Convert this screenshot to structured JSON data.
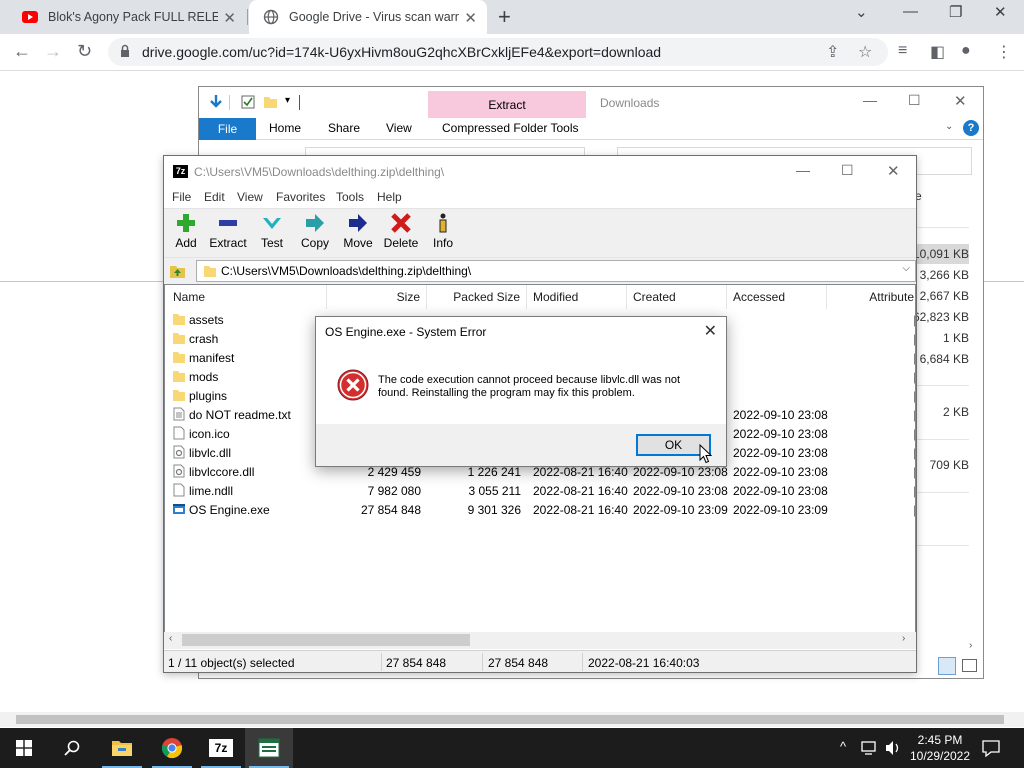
{
  "browser": {
    "tabs": [
      {
        "title": "Blok's Agony Pack FULL RELEASE",
        "active": false
      },
      {
        "title": "Google Drive - Virus scan warning",
        "active": true
      }
    ],
    "url": "drive.google.com/uc?id=174k-U6yxHivm8ouG2qhcXBrCxkljEFe4&export=download"
  },
  "explorer": {
    "ribbon": {
      "file": "File",
      "home": "Home",
      "share": "Share",
      "view": "View",
      "extract": "Extract",
      "compressed_tools": "Compressed Folder Tools",
      "title": "Downloads"
    },
    "column_fragment": "e",
    "sizes": [
      "10,091 KB",
      "3,266 KB",
      "2,667 KB",
      "62,823 KB",
      "1 KB",
      "6,684 KB",
      "2 KB",
      "709 KB"
    ]
  },
  "sevenzip": {
    "title": "C:\\Users\\VM5\\Downloads\\delthing.zip\\delthing\\",
    "menu": [
      "File",
      "Edit",
      "View",
      "Favorites",
      "Tools",
      "Help"
    ],
    "toolbar": [
      {
        "label": "Add",
        "icon": "plus-icon"
      },
      {
        "label": "Extract",
        "icon": "minus-icon"
      },
      {
        "label": "Test",
        "icon": "check-icon"
      },
      {
        "label": "Copy",
        "icon": "copy-arrow-icon"
      },
      {
        "label": "Move",
        "icon": "move-arrow-icon"
      },
      {
        "label": "Delete",
        "icon": "delete-x-icon"
      },
      {
        "label": "Info",
        "icon": "info-icon"
      }
    ],
    "address": "C:\\Users\\VM5\\Downloads\\delthing.zip\\delthing\\",
    "columns": {
      "name": "Name",
      "size": "Size",
      "packed": "Packed Size",
      "modified": "Modified",
      "created": "Created",
      "accessed": "Accessed",
      "attributes": "Attribute"
    },
    "rows": [
      {
        "name": "assets",
        "type": "folder",
        "size": "",
        "packed": "",
        "modified": "",
        "created": "",
        "accessed": ""
      },
      {
        "name": "crash",
        "type": "folder",
        "size": "",
        "packed": "",
        "modified": "",
        "created": "",
        "accessed": ""
      },
      {
        "name": "manifest",
        "type": "folder",
        "size": "",
        "packed": "",
        "modified": "",
        "created": "",
        "accessed": ""
      },
      {
        "name": "mods",
        "type": "folder",
        "size": "",
        "packed": "",
        "modified": "",
        "created": "",
        "accessed": ""
      },
      {
        "name": "plugins",
        "type": "folder",
        "size": "",
        "packed": "",
        "modified": "",
        "created": "",
        "accessed": ""
      },
      {
        "name": "do NOT readme.txt",
        "type": "text",
        "size": "",
        "packed": "",
        "modified": "",
        "created": "",
        "accessed": "2022-09-10 23:08"
      },
      {
        "name": "icon.ico",
        "type": "file",
        "size": "",
        "packed": "",
        "modified": "",
        "created": "",
        "accessed": "2022-09-10 23:08"
      },
      {
        "name": "libvlc.dll",
        "type": "dll",
        "size": "",
        "packed": "",
        "modified": "",
        "created": "",
        "accessed": "2022-09-10 23:08"
      },
      {
        "name": "libvlccore.dll",
        "type": "dll",
        "size": "2 429 459",
        "packed": "1 226 241",
        "modified": "2022-08-21 16:40",
        "created": "2022-09-10 23:08",
        "accessed": "2022-09-10 23:08"
      },
      {
        "name": "lime.ndll",
        "type": "file",
        "size": "7 982 080",
        "packed": "3 055 211",
        "modified": "2022-08-21 16:40",
        "created": "2022-09-10 23:08",
        "accessed": "2022-09-10 23:08"
      },
      {
        "name": "OS Engine.exe",
        "type": "exe",
        "size": "27 854 848",
        "packed": "9 301 326",
        "modified": "2022-08-21 16:40",
        "created": "2022-09-10 23:09",
        "accessed": "2022-09-10 23:09"
      }
    ],
    "status": {
      "selected": "1 / 11 object(s) selected",
      "size": "27 854 848",
      "packed": "27 854 848",
      "modified": "2022-08-21 16:40:03"
    }
  },
  "dialog": {
    "title": "OS Engine.exe - System Error",
    "message": "The code execution cannot proceed because libvlc.dll was not found. Reinstalling the program may fix this problem.",
    "ok": "OK"
  },
  "taskbar": {
    "apps": [
      "start-icon",
      "search-icon",
      "file-explorer-icon",
      "chrome-icon",
      "7zip-icon",
      "excel-window-icon"
    ],
    "time": "2:45 PM",
    "date": "10/29/2022"
  },
  "colors": {
    "ribbon_blue": "#1979ca",
    "extract_pink": "#f8c8dc",
    "error_red": "#d32f2f",
    "ok_border": "#0078d7"
  }
}
